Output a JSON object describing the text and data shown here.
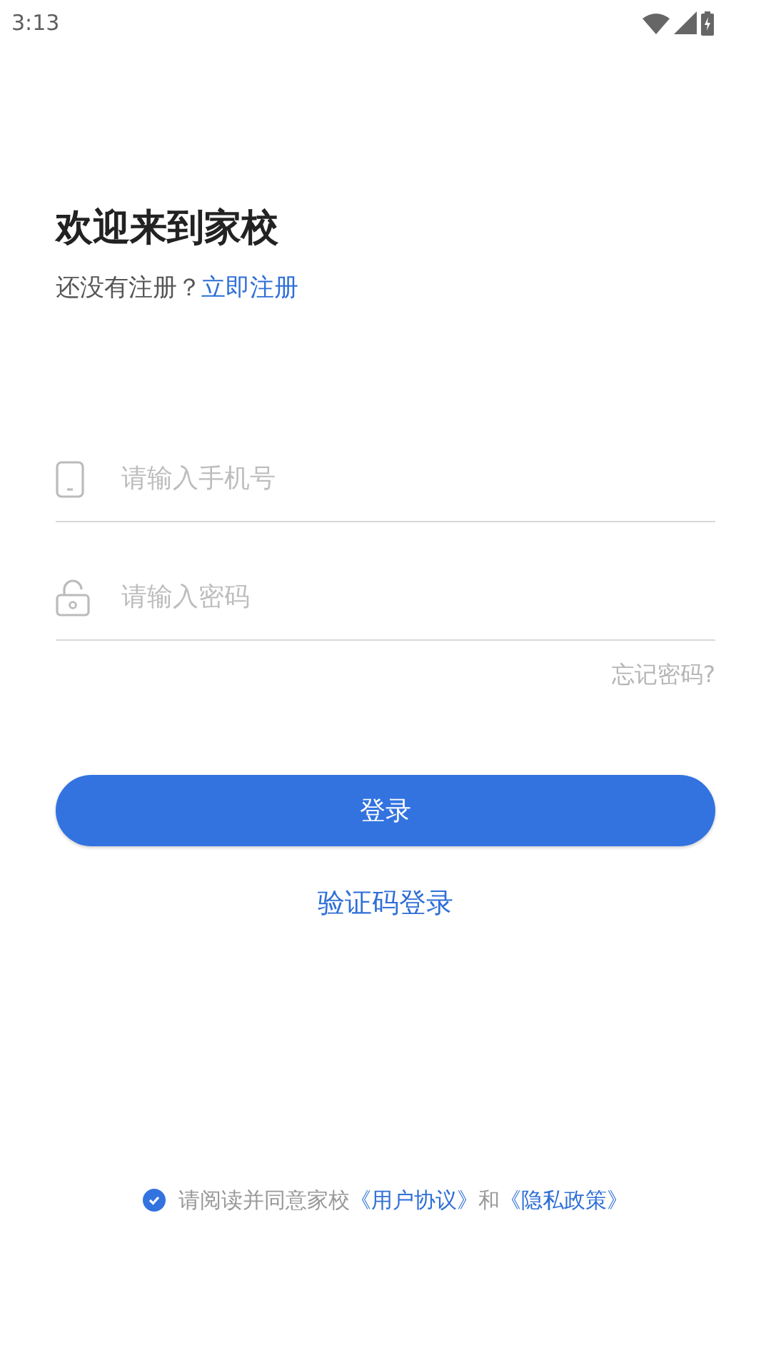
{
  "status_bar": {
    "time": "3:13"
  },
  "title": "欢迎来到家校",
  "register_prompt": {
    "text": "还没有注册？",
    "link": "立即注册"
  },
  "fields": [
    {
      "kind": "phone",
      "placeholder": "请输入手机号"
    },
    {
      "kind": "password",
      "placeholder": "请输入密码"
    }
  ],
  "forgot_password": "忘记密码?",
  "login_button": "登录",
  "code_login": "验证码登录",
  "agreement": {
    "checked": true,
    "text": "请阅读并同意家校",
    "link_1": "《用户协议》",
    "joiner": "和",
    "link_2": "《隐私政策》"
  }
}
